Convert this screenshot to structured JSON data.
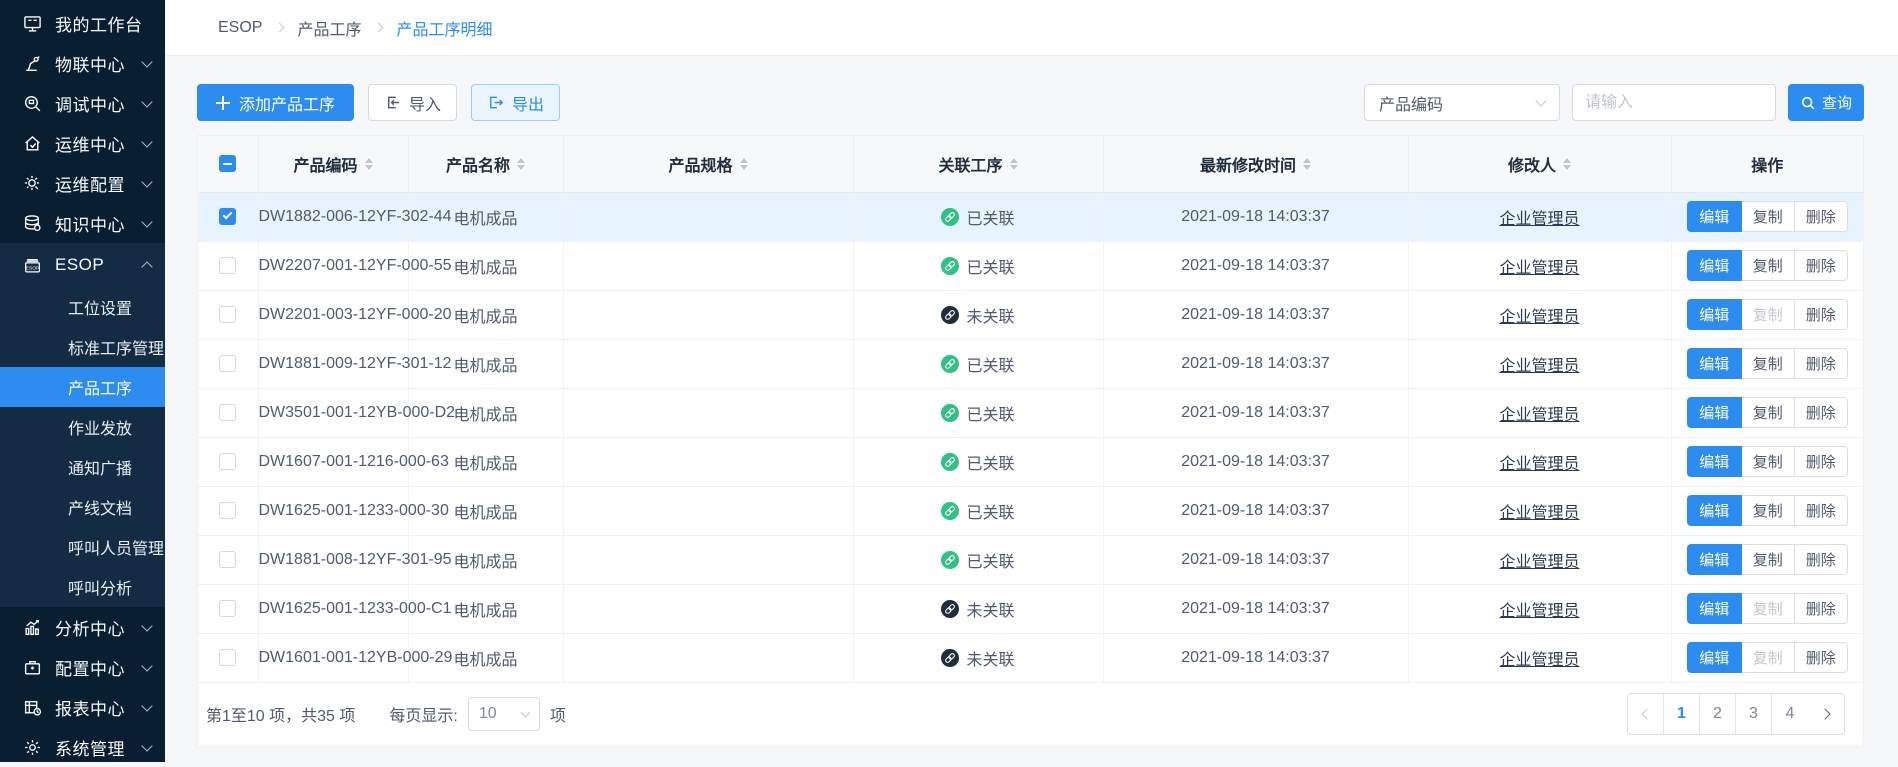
{
  "sidebar": {
    "items": [
      {
        "label": "我的工作台",
        "icon": "monitor-icon",
        "chevron": "none"
      },
      {
        "label": "物联中心",
        "icon": "robot-arm-icon",
        "chevron": "down"
      },
      {
        "label": "调试中心",
        "icon": "debug-magnifier-icon",
        "chevron": "down"
      },
      {
        "label": "运维中心",
        "icon": "house-wrench-icon",
        "chevron": "down"
      },
      {
        "label": "运维配置",
        "icon": "gear-wrench-icon",
        "chevron": "down"
      },
      {
        "label": "知识中心",
        "icon": "database-icon",
        "chevron": "down"
      },
      {
        "label": "ESOP",
        "icon": "esop-icon",
        "chevron": "up"
      }
    ],
    "esop_children": [
      "工位设置",
      "标准工序管理",
      "产品工序",
      "作业发放",
      "通知广播",
      "产线文档",
      "呼叫人员管理",
      "呼叫分析"
    ],
    "active_child": "产品工序",
    "bottom_items": [
      {
        "label": "分析中心",
        "icon": "chart-icon",
        "chevron": "down"
      },
      {
        "label": "配置中心",
        "icon": "toolbox-icon",
        "chevron": "down"
      },
      {
        "label": "报表中心",
        "icon": "report-icon",
        "chevron": "down"
      },
      {
        "label": "系统管理",
        "icon": "gear-icon",
        "chevron": "down"
      }
    ]
  },
  "breadcrumb": {
    "items": [
      "ESOP",
      "产品工序",
      "产品工序明细"
    ],
    "current": "产品工序明细"
  },
  "toolbar": {
    "add_label": "添加产品工序",
    "import_label": "导入",
    "export_label": "导出"
  },
  "search": {
    "field_selected": "产品编码",
    "input_placeholder": "请输入",
    "query_label": "查询"
  },
  "table": {
    "columns": [
      {
        "label": "产品编码",
        "sortable": true
      },
      {
        "label": "产品名称",
        "sortable": true
      },
      {
        "label": "产品规格",
        "sortable": true
      },
      {
        "label": "关联工序",
        "sortable": true
      },
      {
        "label": "最新修改时间",
        "sortable": true
      },
      {
        "label": "修改人",
        "sortable": true
      },
      {
        "label": "操作",
        "sortable": false
      }
    ],
    "status_linked": "已关联",
    "status_unlinked": "未关联",
    "actions": {
      "edit": "编辑",
      "copy": "复制",
      "delete": "删除"
    },
    "rows": [
      {
        "code": "DW1882-006-12YF-302-44",
        "name": "电机成品",
        "spec": "",
        "linked": true,
        "time": "2021-09-18 14:03:37",
        "modifier": "企业管理员",
        "checked": true,
        "selected": true
      },
      {
        "code": "DW2207-001-12YF-000-55",
        "name": "电机成品",
        "spec": "",
        "linked": true,
        "time": "2021-09-18 14:03:37",
        "modifier": "企业管理员",
        "checked": false,
        "selected": false
      },
      {
        "code": "DW2201-003-12YF-000-20",
        "name": "电机成品",
        "spec": "",
        "linked": false,
        "time": "2021-09-18 14:03:37",
        "modifier": "企业管理员",
        "checked": false,
        "selected": false
      },
      {
        "code": "DW1881-009-12YF-301-12",
        "name": "电机成品",
        "spec": "",
        "linked": true,
        "time": "2021-09-18 14:03:37",
        "modifier": "企业管理员",
        "checked": false,
        "selected": false
      },
      {
        "code": "DW3501-001-12YB-000-D2",
        "name": "电机成品",
        "spec": "",
        "linked": true,
        "time": "2021-09-18 14:03:37",
        "modifier": "企业管理员",
        "checked": false,
        "selected": false
      },
      {
        "code": "DW1607-001-1216-000-63",
        "name": "电机成品",
        "spec": "",
        "linked": true,
        "time": "2021-09-18 14:03:37",
        "modifier": "企业管理员",
        "checked": false,
        "selected": false
      },
      {
        "code": "DW1625-001-1233-000-30",
        "name": "电机成品",
        "spec": "",
        "linked": true,
        "time": "2021-09-18 14:03:37",
        "modifier": "企业管理员",
        "checked": false,
        "selected": false
      },
      {
        "code": "DW1881-008-12YF-301-95",
        "name": "电机成品",
        "spec": "",
        "linked": true,
        "time": "2021-09-18 14:03:37",
        "modifier": "企业管理员",
        "checked": false,
        "selected": false
      },
      {
        "code": "DW1625-001-1233-000-C1",
        "name": "电机成品",
        "spec": "",
        "linked": false,
        "time": "2021-09-18 14:03:37",
        "modifier": "企业管理员",
        "checked": false,
        "selected": false
      },
      {
        "code": "DW1601-001-12YB-000-29",
        "name": "电机成品",
        "spec": "",
        "linked": false,
        "time": "2021-09-18 14:03:37",
        "modifier": "企业管理员",
        "checked": false,
        "selected": false
      }
    ]
  },
  "footer": {
    "range_text": "第1至10 项，共35  项",
    "per_page_label": "每页显示:",
    "per_page_value": "10",
    "per_page_suffix": "项",
    "pages": [
      "1",
      "2",
      "3",
      "4"
    ],
    "active_page": "1",
    "prev_disabled": true
  },
  "colors": {
    "accent_blue": "#2d8cf0",
    "linked_green": "#30c185",
    "unlinked_dark": "#1f2d3d",
    "sidebar_bg": "#0a1e32",
    "sidebar_expanded_bg": "#142c43",
    "selected_row_bg": "#e7f3fd",
    "export_button_bg": "#ebf5ff"
  }
}
